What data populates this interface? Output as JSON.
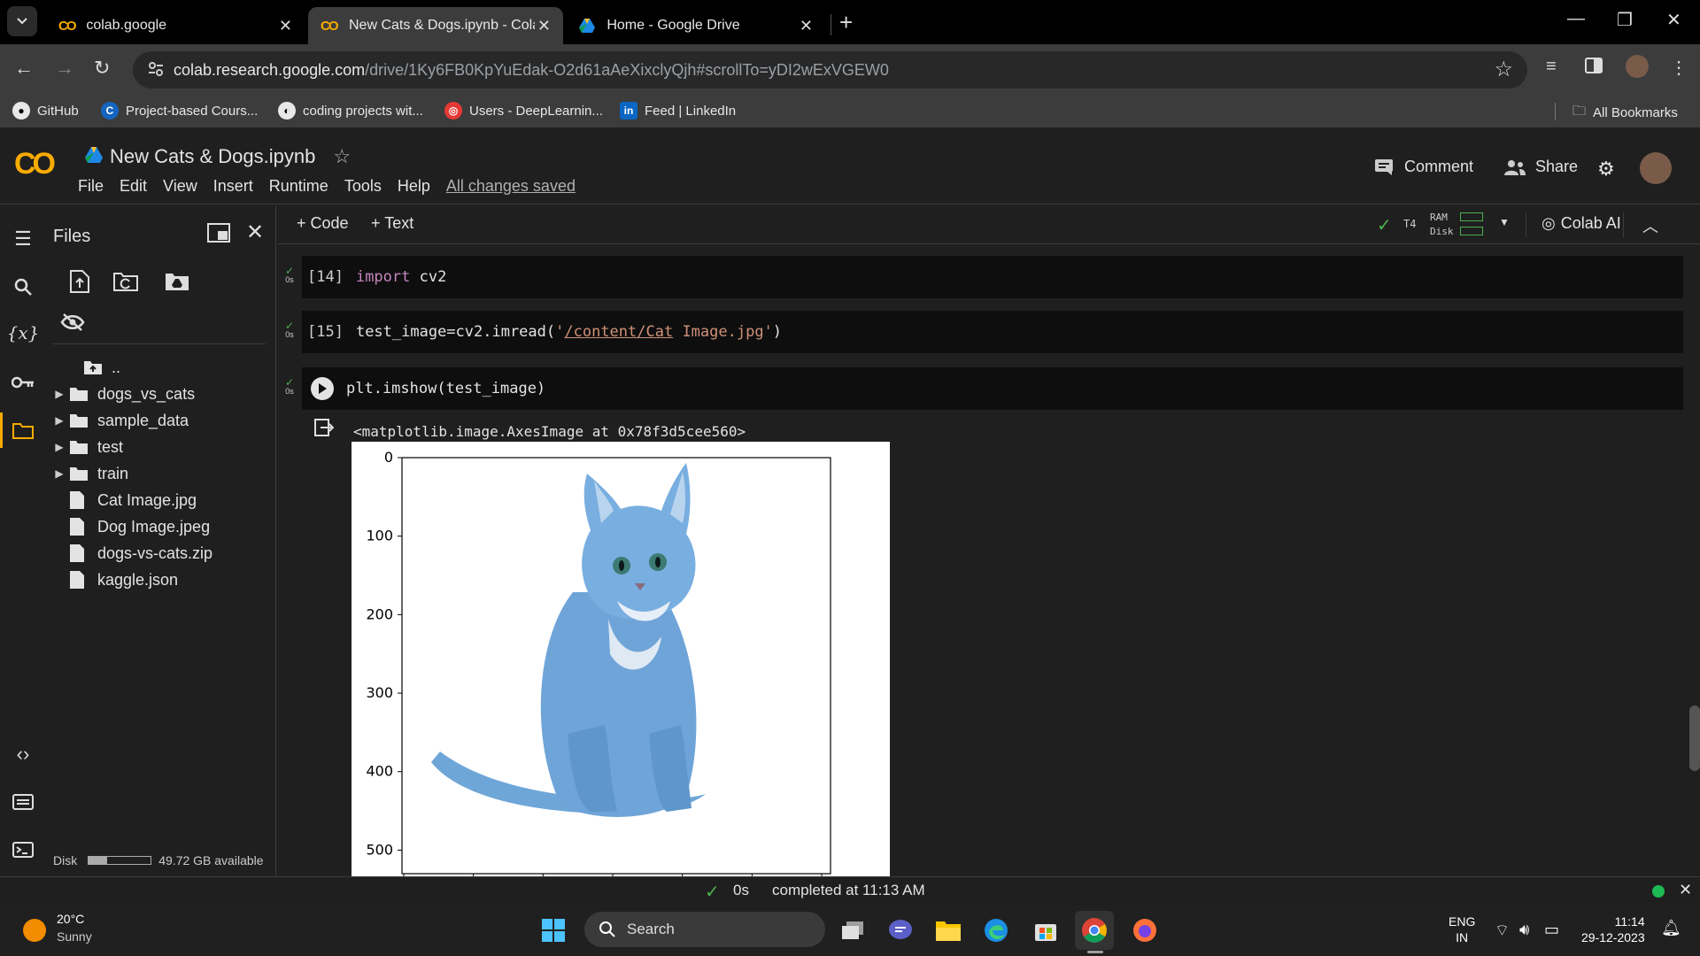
{
  "browser": {
    "tabs": [
      {
        "title": "colab.google"
      },
      {
        "title": "New Cats & Dogs.ipynb - Colab"
      },
      {
        "title": "Home - Google Drive"
      }
    ],
    "url_host": "colab.research.google.com",
    "url_path": "/drive/1Ky6FB0KpYuEdak-O2d61aAeXixclyQjh#scrollTo=yDI2wExVGEW0",
    "bookmarks": [
      "GitHub",
      "Project-based Cours...",
      "coding projects wit...",
      "Users - DeepLearnin...",
      "Feed | LinkedIn"
    ],
    "all_bookmarks": "All Bookmarks"
  },
  "colab": {
    "logo": "CO",
    "notebook_title": "New Cats & Dogs.ipynb",
    "menu": [
      "File",
      "Edit",
      "View",
      "Insert",
      "Runtime",
      "Tools",
      "Help"
    ],
    "saved_status": "All changes saved",
    "comment": "Comment",
    "share": "Share",
    "toolbar": {
      "code": "Code",
      "text": "Text",
      "runtime": "T4",
      "ram": "RAM",
      "disk": "Disk",
      "colab_ai": "Colab AI"
    }
  },
  "files": {
    "title": "Files",
    "parent": "..",
    "items": [
      {
        "name": "dogs_vs_cats",
        "type": "folder"
      },
      {
        "name": "sample_data",
        "type": "folder"
      },
      {
        "name": "test",
        "type": "folder"
      },
      {
        "name": "train",
        "type": "folder"
      },
      {
        "name": "Cat Image.jpg",
        "type": "file"
      },
      {
        "name": "Dog Image.jpeg",
        "type": "file"
      },
      {
        "name": "dogs-vs-cats.zip",
        "type": "file"
      },
      {
        "name": "kaggle.json",
        "type": "file"
      }
    ],
    "disk_label": "Disk",
    "disk_available": "49.72 GB available",
    "disk_used_fraction": 0.3
  },
  "cells": [
    {
      "exec": "[14]",
      "time": "0s",
      "code_kw": "import",
      "code_rest": " cv2"
    },
    {
      "exec": "[15]",
      "time": "0s",
      "code_pre": "test_image=cv2.imread(",
      "code_str_a": "'",
      "code_str_path": "/content/Cat",
      "code_str_b": " Image.jpg'",
      "code_post": ")"
    },
    {
      "time": "0s",
      "code": "plt.imshow(test_image)"
    }
  ],
  "output_text": "<matplotlib.image.AxesImage at 0x78f3d5cee560>",
  "chart_data": {
    "type": "image",
    "yticks": [
      0,
      100,
      200,
      300,
      400,
      500
    ],
    "xticks_count": 7,
    "ylim": [
      0,
      530
    ],
    "content": "blue-tinted cat"
  },
  "status": {
    "time": "0s",
    "text": "completed at 11:13 AM"
  },
  "taskbar": {
    "temp": "20°C",
    "weather": "Sunny",
    "search": "Search",
    "lang1": "ENG",
    "lang2": "IN",
    "clock": "11:14",
    "date": "29-12-2023"
  }
}
